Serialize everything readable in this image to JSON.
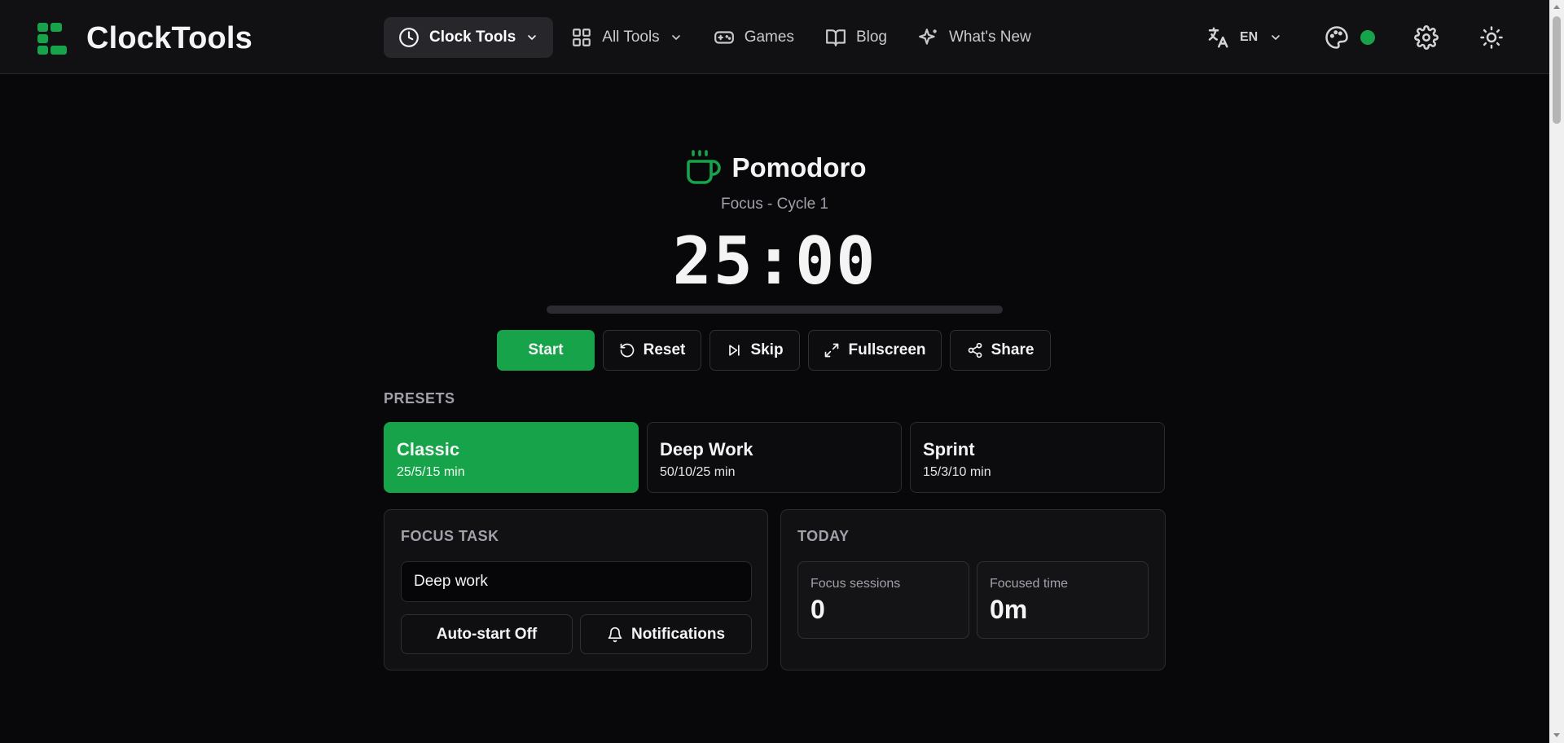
{
  "header": {
    "brand": "ClockTools",
    "nav": [
      {
        "label": "Clock Tools",
        "icon": "clock-icon",
        "dropdown": true,
        "active": true
      },
      {
        "label": "All Tools",
        "icon": "grid-icon",
        "dropdown": true
      },
      {
        "label": "Games",
        "icon": "gamepad-icon"
      },
      {
        "label": "Blog",
        "icon": "book-icon"
      },
      {
        "label": "What's New",
        "icon": "sparkles-icon"
      }
    ],
    "language": "EN",
    "theme_status_color": "#16a34a"
  },
  "timer": {
    "title": "Pomodoro",
    "icon": "coffee-cup-icon",
    "subtitle": "Focus - Cycle 1",
    "display": "25:00",
    "progress": 0
  },
  "controls": {
    "start": "Start",
    "reset": "Reset",
    "skip": "Skip",
    "fullscreen": "Fullscreen",
    "share": "Share"
  },
  "presets": {
    "label": "PRESETS",
    "items": [
      {
        "name": "Classic",
        "meta": "25/5/15 min",
        "active": true
      },
      {
        "name": "Deep Work",
        "meta": "50/10/25 min"
      },
      {
        "name": "Sprint",
        "meta": "15/3/10 min"
      }
    ]
  },
  "focus_task": {
    "label": "FOCUS TASK",
    "value": "Deep work",
    "auto_start": "Auto-start Off",
    "notifications": "Notifications"
  },
  "today": {
    "label": "TODAY",
    "sessions_label": "Focus sessions",
    "sessions_value": "0",
    "time_label": "Focused time",
    "time_value": "0m"
  },
  "colors": {
    "accent": "#16a34a",
    "background": "#08080b",
    "header": "#111114"
  }
}
